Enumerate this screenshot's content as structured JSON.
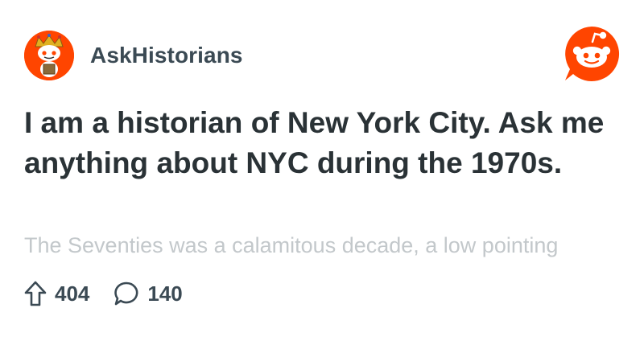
{
  "community": {
    "name": "AskHistorians",
    "avatar_icon": "crowned-snoo-avatar-icon"
  },
  "brand": {
    "logo_icon": "reddit-snoo-logo-icon",
    "accent": "#ff4500"
  },
  "post": {
    "title": "I am a historian of New York City. Ask me anything about NYC during the 1970s.",
    "preview": "The Seventies was a calamitous decade, a low pointing"
  },
  "stats": {
    "upvotes": "404",
    "comments": "140",
    "upvote_icon": "upvote-arrow-icon",
    "comment_icon": "comment-bubble-icon"
  },
  "colors": {
    "title": "#2a3236",
    "secondary_text": "#3b4a54",
    "preview_text": "#c3c8cb"
  }
}
